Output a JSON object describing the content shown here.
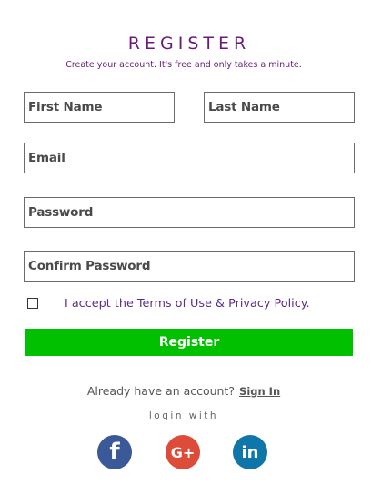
{
  "header": {
    "title": "REGISTER",
    "subtitle": "Create your account. It's free and only takes a minute."
  },
  "form": {
    "first_name_placeholder": "First Name",
    "last_name_placeholder": "Last Name",
    "email_placeholder": "Email",
    "password_placeholder": "Password",
    "confirm_password_placeholder": "Confirm Password",
    "terms": {
      "prefix": "I accept the ",
      "terms_link": "Terms of Use",
      "joiner": " & ",
      "privacy_link": "Privacy Policy",
      "suffix": ".",
      "checked": false
    },
    "register_label": "Register"
  },
  "footer": {
    "already_text": "Already have an account?",
    "sign_in_label": "Sign In",
    "login_with": "login with",
    "social": [
      {
        "name": "facebook",
        "glyph": "f",
        "color": "#3b5998"
      },
      {
        "name": "google-plus",
        "glyph": "G+",
        "color": "#dd4b39"
      },
      {
        "name": "linkedin",
        "glyph": "in",
        "color": "#0e76a8"
      }
    ]
  }
}
